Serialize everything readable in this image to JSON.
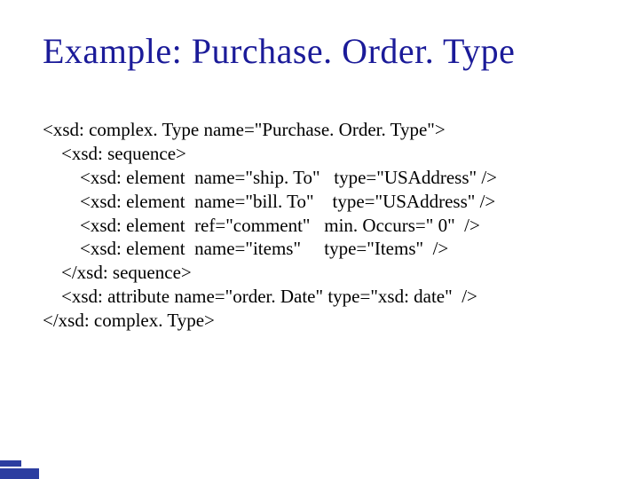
{
  "title": "Example: Purchase. Order. Type",
  "code": {
    "l1": "<xsd: complex. Type name=\"Purchase. Order. Type\">",
    "l2": "    <xsd: sequence>",
    "l3": "        <xsd: element  name=\"ship. To\"   type=\"USAddress\" />",
    "l4": "        <xsd: element  name=\"bill. To\"    type=\"USAddress\" />",
    "l5": "        <xsd: element  ref=\"comment\"   min. Occurs=\" 0\"  />",
    "l6": "        <xsd: element  name=\"items\"     type=\"Items\"  />",
    "l7": "    </xsd: sequence>",
    "l8": "    <xsd: attribute name=\"order. Date\" type=\"xsd: date\"  />",
    "l9": "</xsd: complex. Type>"
  }
}
